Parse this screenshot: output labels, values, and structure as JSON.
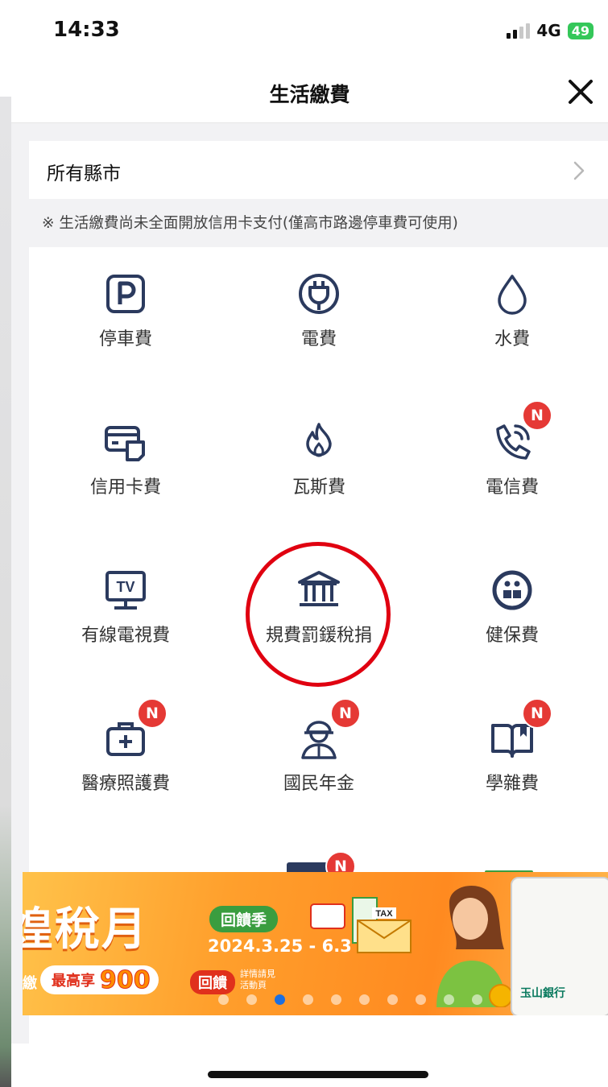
{
  "status": {
    "time": "14:33",
    "network": "4G",
    "battery": "49"
  },
  "header": {
    "title": "生活繳費"
  },
  "city": {
    "label": "所有縣市"
  },
  "notice": "※ 生活繳費尚未全面開放信用卡支付(僅高市路邊停車費可使用)",
  "items": [
    {
      "label": "停車費",
      "icon": "parking-icon",
      "badge": ""
    },
    {
      "label": "電費",
      "icon": "electric-plug-icon",
      "badge": ""
    },
    {
      "label": "水費",
      "icon": "water-drop-icon",
      "badge": ""
    },
    {
      "label": "信用卡費",
      "icon": "credit-card-icon",
      "badge": ""
    },
    {
      "label": "瓦斯費",
      "icon": "gas-flame-icon",
      "badge": ""
    },
    {
      "label": "電信費",
      "icon": "phone-icon",
      "badge": "N"
    },
    {
      "label": "有線電視費",
      "icon": "tv-icon",
      "badge": ""
    },
    {
      "label": "規費罰鍰稅捐",
      "icon": "government-building-icon",
      "badge": ""
    },
    {
      "label": "健保費",
      "icon": "health-insurance-icon",
      "badge": ""
    },
    {
      "label": "醫療照護費",
      "icon": "medical-kit-icon",
      "badge": "N"
    },
    {
      "label": "國民年金",
      "icon": "worker-icon",
      "badge": "N"
    },
    {
      "label": "學雜費",
      "icon": "book-icon",
      "badge": "N"
    }
  ],
  "next_row_badge": "N",
  "banner": {
    "title": "煌稅月",
    "tag": "回饋季",
    "date": "2024.3.25 - 6.3",
    "prefix": "繳",
    "max_label": "最高享",
    "amount": "900",
    "reward": "回饋",
    "detail_line1": "詳情請見",
    "detail_line2": "活動頁",
    "tax_label": "TAX",
    "bank": "玉山銀行",
    "active_dot": 2,
    "dot_count": 10
  },
  "colors": {
    "accent_red": "#e53935",
    "annotation_circle": "#e00010",
    "icon_navy": "#2b3a5e",
    "banner_orange": "#ff9f2c"
  }
}
